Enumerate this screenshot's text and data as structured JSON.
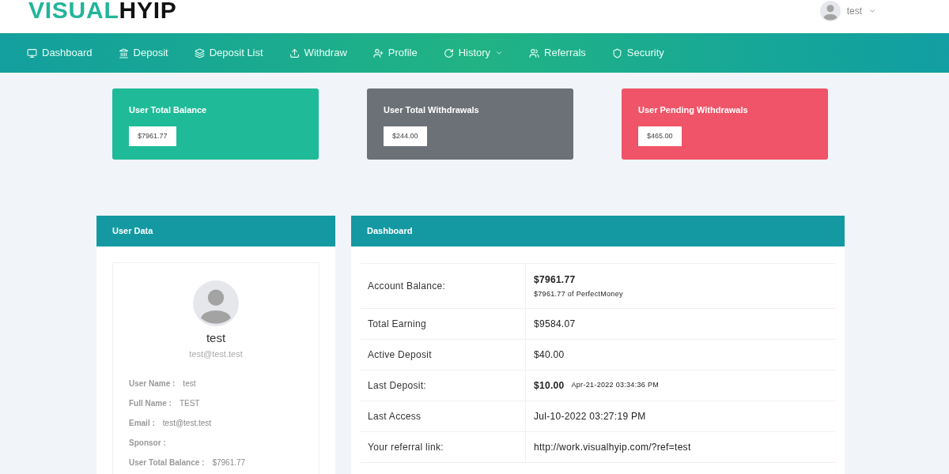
{
  "logo": {
    "part_1": "VISUAL",
    "part_2": "HYIP"
  },
  "user_menu": {
    "name": "test"
  },
  "nav": [
    {
      "label": "Dashboard",
      "dropdown": false
    },
    {
      "label": "Deposit",
      "dropdown": false
    },
    {
      "label": "Deposit List",
      "dropdown": false
    },
    {
      "label": "Withdraw",
      "dropdown": false
    },
    {
      "label": "Profile",
      "dropdown": false
    },
    {
      "label": "History",
      "dropdown": true
    },
    {
      "label": "Referrals",
      "dropdown": false
    },
    {
      "label": "Security",
      "dropdown": false
    }
  ],
  "stat_cards": [
    {
      "title": "User Total Balance",
      "value": "$7961.77",
      "color": "#1fbb98"
    },
    {
      "title": "User Total Withdrawals",
      "value": "$244.00",
      "color": "#6c7177"
    },
    {
      "title": "User Pending Withdrawals",
      "value": "$465.00",
      "color": "#ef5468"
    }
  ],
  "user_data": {
    "title": "User Data",
    "name": "test",
    "email": "test@test.test",
    "fields": [
      {
        "label": "User Name :",
        "value": "test"
      },
      {
        "label": "Full Name :",
        "value": "TEST"
      },
      {
        "label": "Email :",
        "value": "test@test.test"
      },
      {
        "label": "Sponsor :"
      },
      {
        "label": "User Total Balance :",
        "value": "$7961.77"
      }
    ]
  },
  "dashboard": {
    "title": "Dashboard",
    "rows": [
      {
        "label": "Account Balance:",
        "kind": "stacked",
        "value": "$7961.77",
        "note": "$7961.77 of PerfectMoney"
      },
      {
        "label": "Total Earning",
        "kind": "plain",
        "value": "$9584.07"
      },
      {
        "label": "Active Deposit",
        "kind": "plain",
        "value": "$40.00"
      },
      {
        "label": "Last Deposit:",
        "kind": "inline",
        "value": "$10.00",
        "note": "Apr-21-2022 03:34:36 PM"
      },
      {
        "label": "Last Access",
        "kind": "plain",
        "value": "Jul-10-2022 03:27:19 PM"
      },
      {
        "label": "Your referral link:",
        "kind": "plain",
        "value": "http://work.visualhyip.com/?ref=test"
      }
    ]
  }
}
